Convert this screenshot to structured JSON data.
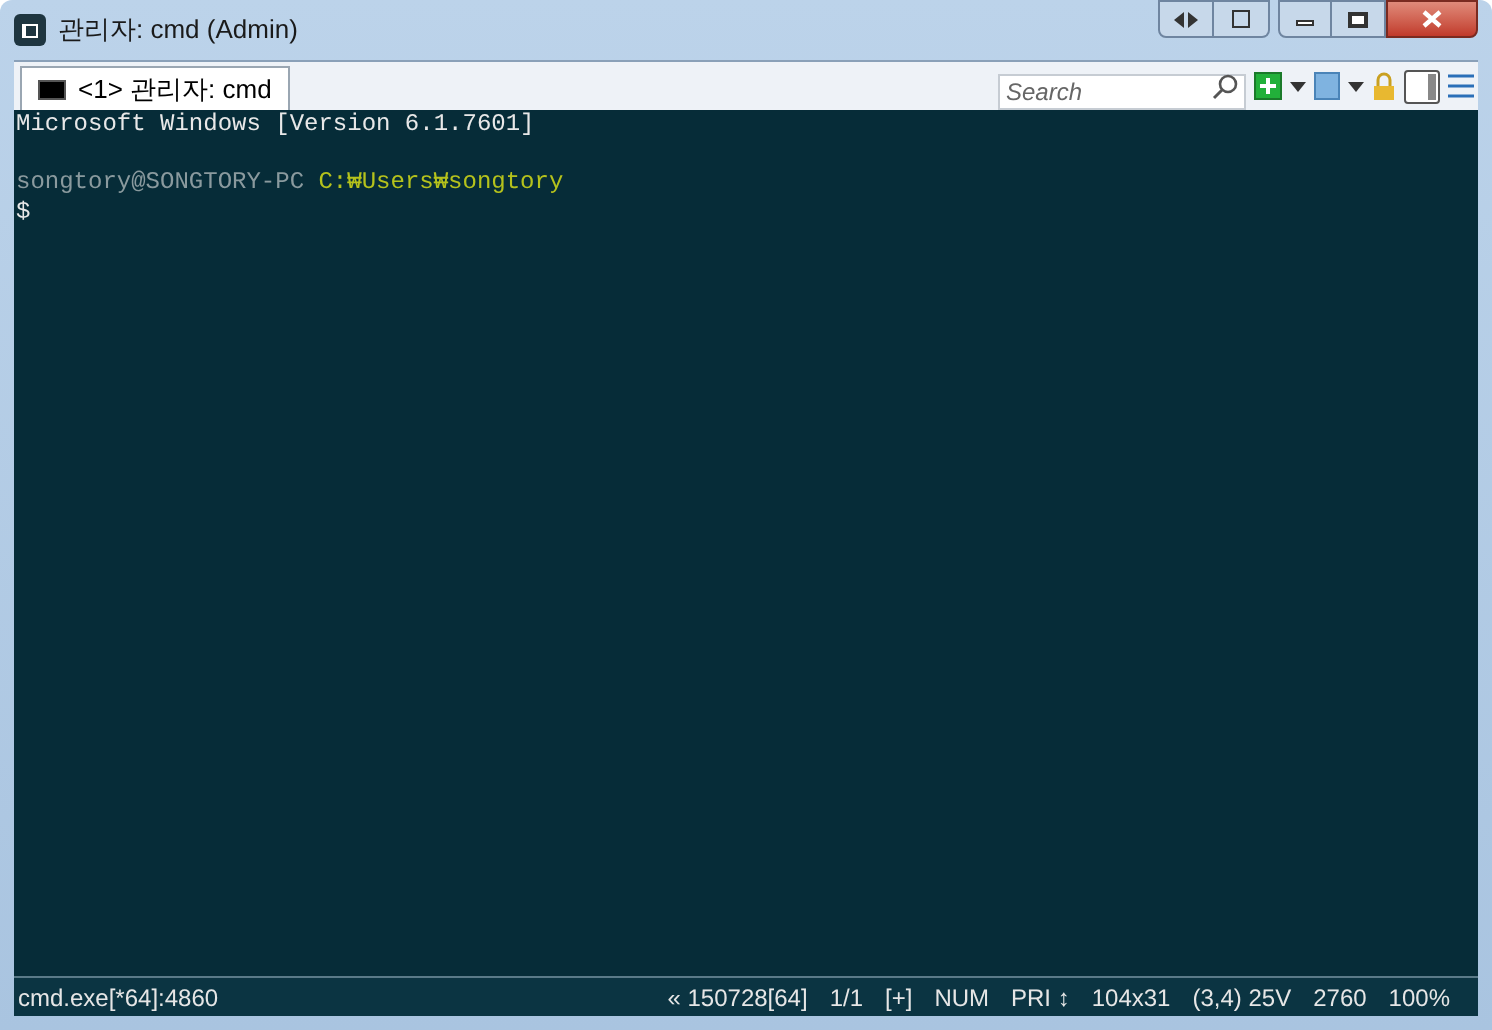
{
  "window": {
    "title": "관리자: cmd (Admin)"
  },
  "tab": {
    "number": "<1>",
    "label": "관리자: cmd",
    "selected": true
  },
  "search": {
    "placeholder": "Search"
  },
  "console": {
    "lines": [
      {
        "kind": "text",
        "segments": [
          {
            "kind": "plain",
            "text": "Microsoft Windows [Version 6.1.7601]"
          }
        ]
      },
      {
        "kind": "blank"
      },
      {
        "kind": "text",
        "segments": [
          {
            "kind": "user",
            "text": "songtory@SONGTORY-PC"
          },
          {
            "kind": "path",
            "text": " C:₩Users₩songtory"
          }
        ]
      },
      {
        "kind": "text",
        "segments": [
          {
            "kind": "plain",
            "text": "$"
          }
        ]
      }
    ]
  },
  "status_bar": {
    "left": "cmd.exe[*64]:4860",
    "items": [
      "« 150728[64]",
      "1/1",
      "[+]",
      "NUM",
      "PRI ↕",
      "104x31",
      "(3,4) 25V",
      "2760",
      "100%"
    ]
  }
}
